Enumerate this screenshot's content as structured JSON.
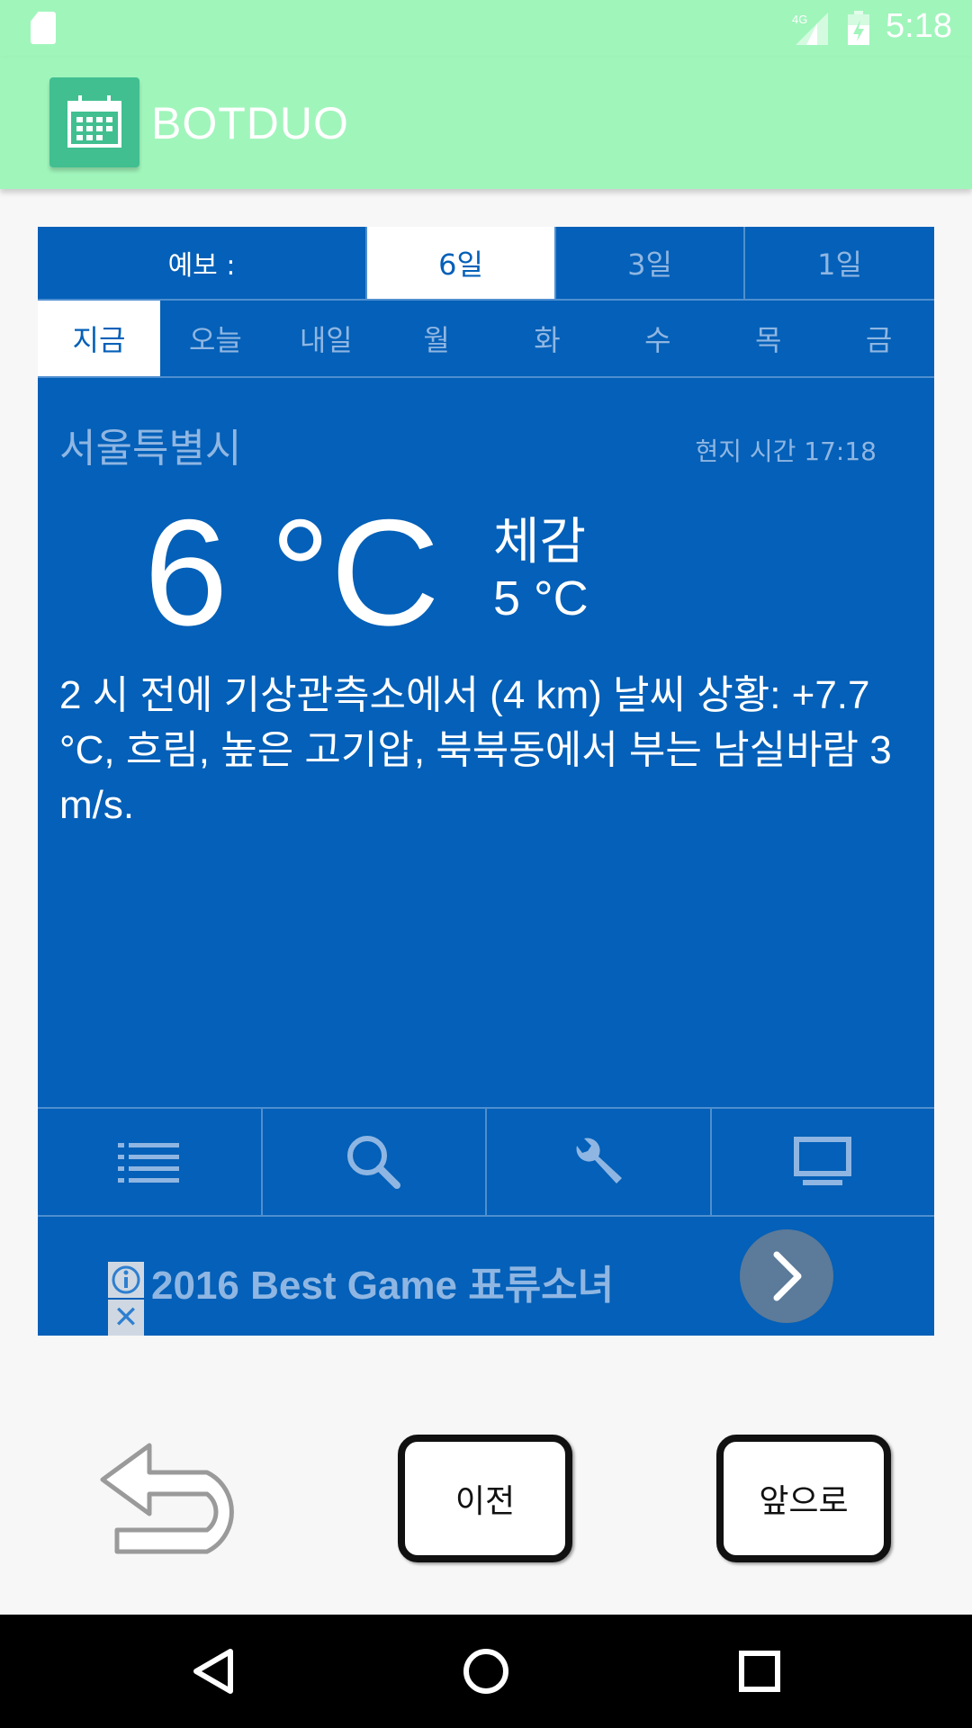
{
  "status_bar": {
    "time": "5:18",
    "network": "4G",
    "icons": [
      "sd-card-icon",
      "signal-icon",
      "battery-icon"
    ]
  },
  "app_bar": {
    "title": "BOTDUO",
    "icon": "calendar-icon"
  },
  "forecast": {
    "label": "예보 :",
    "tabs": [
      {
        "label": "6일",
        "active": true
      },
      {
        "label": "3일",
        "active": false
      },
      {
        "label": "1일",
        "active": false
      }
    ]
  },
  "days": [
    {
      "label": "지금",
      "active": true
    },
    {
      "label": "오늘",
      "active": false
    },
    {
      "label": "내일",
      "active": false
    },
    {
      "label": "월",
      "active": false
    },
    {
      "label": "화",
      "active": false
    },
    {
      "label": "수",
      "active": false
    },
    {
      "label": "목",
      "active": false
    },
    {
      "label": "금",
      "active": false
    }
  ],
  "weather": {
    "city": "서울특별시",
    "local_time": "현지 시간  17:18",
    "temperature": "6 °C",
    "feels_label": "체감",
    "feels_value": "5 °C",
    "description": "2 시 전에 기상관측소에서 (4 km) 날씨 상황: +7.7 °C, 흐림, 높은 고기압, 북북동에서 부는 남실바람 3 m/s."
  },
  "toolbar": {
    "icons": [
      "list-icon",
      "search-icon",
      "wrench-icon",
      "monitor-icon"
    ]
  },
  "ad": {
    "text": "2016 Best Game 표류소녀",
    "close_glyph": "✕"
  },
  "bottom_buttons": {
    "prev_label": "이전",
    "next_label": "앞으로"
  },
  "colors": {
    "status_bar": "#a0f5bb",
    "panel": "#0460b8",
    "app_icon": "#41bf91",
    "inactive_text": "#8fb6e2"
  }
}
